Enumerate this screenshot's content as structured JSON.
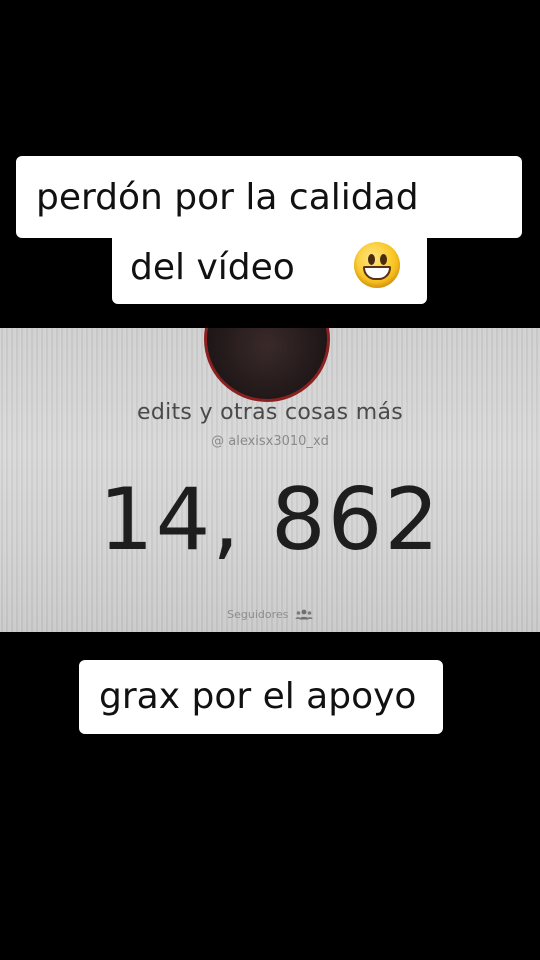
{
  "captions": {
    "top_line1": "perdón por la calidad",
    "top_line2": "del vídeo",
    "bottom": "grax por el apoyo"
  },
  "emoji_icon": "grinning-sweat-face",
  "profile": {
    "channel_title": "edits y otras cosas más",
    "handle": "@ alexisx3010_xd",
    "subscriber_count": "14, 862",
    "count_label": "Seguidores",
    "count_icon": "people-icon"
  },
  "colors": {
    "background": "#000000",
    "caption_bg": "#ffffff",
    "screen_bg": "#d4d4d4",
    "count_text": "#1e1e1e",
    "avatar_ring": "#8a2020"
  }
}
